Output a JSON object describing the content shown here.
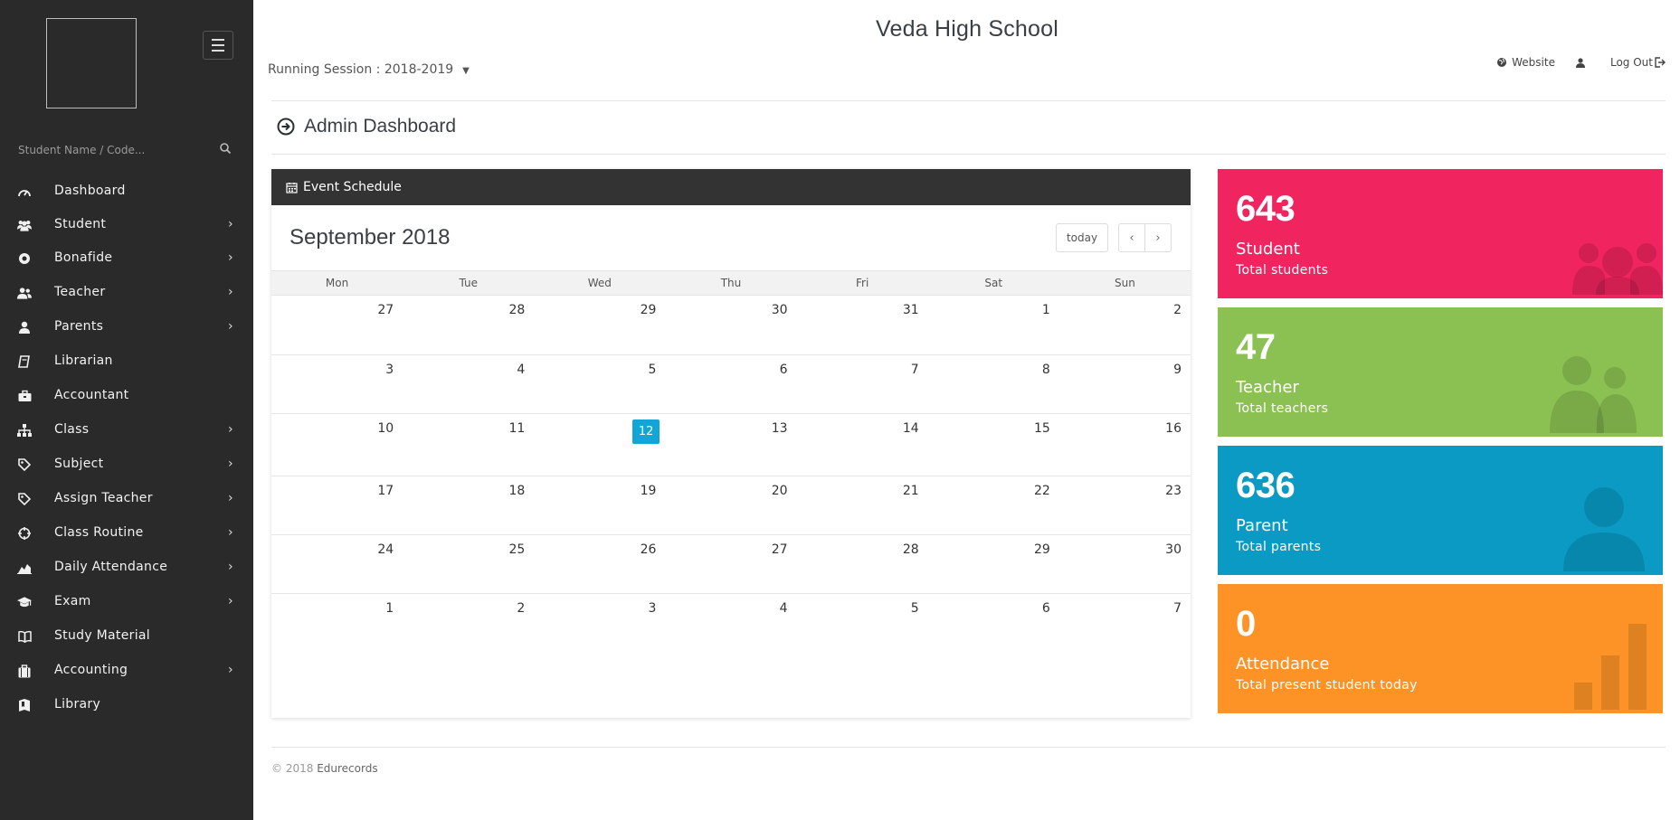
{
  "sidebar": {
    "search_placeholder": "Student Name / Code...",
    "items": [
      {
        "label": "Dashboard",
        "icon": "dashboard-gauge-icon",
        "has_submenu": false
      },
      {
        "label": "Student",
        "icon": "users-group-icon",
        "has_submenu": true
      },
      {
        "label": "Bonafide",
        "icon": "circle-dot-icon",
        "has_submenu": true
      },
      {
        "label": "Teacher",
        "icon": "user-pair-icon",
        "has_submenu": true
      },
      {
        "label": "Parents",
        "icon": "user-icon",
        "has_submenu": true
      },
      {
        "label": "Librarian",
        "icon": "book-icon",
        "has_submenu": false
      },
      {
        "label": "Accountant",
        "icon": "briefcase-icon",
        "has_submenu": false
      },
      {
        "label": "Class",
        "icon": "sitemap-icon",
        "has_submenu": true
      },
      {
        "label": "Subject",
        "icon": "tag-icon",
        "has_submenu": true
      },
      {
        "label": "Assign Teacher",
        "icon": "tag-icon",
        "has_submenu": true
      },
      {
        "label": "Class Routine",
        "icon": "crosshair-icon",
        "has_submenu": true
      },
      {
        "label": "Daily Attendance",
        "icon": "area-chart-icon",
        "has_submenu": true
      },
      {
        "label": "Exam",
        "icon": "graduation-cap-icon",
        "has_submenu": true
      },
      {
        "label": "Study Material",
        "icon": "open-book-icon",
        "has_submenu": false
      },
      {
        "label": "Accounting",
        "icon": "suitcase-icon",
        "has_submenu": true
      },
      {
        "label": "Library",
        "icon": "bookmark-book-icon",
        "has_submenu": false
      }
    ],
    "chevron": "›"
  },
  "header": {
    "school_name": "Veda High School",
    "session_label": "Running Session : 2018-2019",
    "session_caret": "▼",
    "links": {
      "website": "Website",
      "logout": "Log Out"
    }
  },
  "page": {
    "title": "Admin Dashboard"
  },
  "calendar": {
    "panel_title": "Event Schedule",
    "month_title": "September 2018",
    "today_label": "today",
    "prev_label": "‹",
    "next_label": "›",
    "days_of_week": [
      "Mon",
      "Tue",
      "Wed",
      "Thu",
      "Fri",
      "Sat",
      "Sun"
    ],
    "weeks": [
      [
        "27",
        "28",
        "29",
        "30",
        "31",
        "1",
        "2"
      ],
      [
        "3",
        "4",
        "5",
        "6",
        "7",
        "8",
        "9"
      ],
      [
        "10",
        "11",
        "12",
        "13",
        "14",
        "15",
        "16"
      ],
      [
        "17",
        "18",
        "19",
        "20",
        "21",
        "22",
        "23"
      ],
      [
        "24",
        "25",
        "26",
        "27",
        "28",
        "29",
        "30"
      ],
      [
        "1",
        "2",
        "3",
        "4",
        "5",
        "6",
        "7"
      ]
    ],
    "today_date": "12",
    "today_color": "#12a6d6"
  },
  "stats": [
    {
      "count": "643",
      "label": "Student",
      "sub": "Total students",
      "color": "#f0245f",
      "icon": "users-group-icon"
    },
    {
      "count": "47",
      "label": "Teacher",
      "sub": "Total teachers",
      "color": "#8bc152",
      "icon": "user-pair-icon"
    },
    {
      "count": "636",
      "label": "Parent",
      "sub": "Total parents",
      "color": "#0a9ac4",
      "icon": "user-icon"
    },
    {
      "count": "0",
      "label": "Attendance",
      "sub": "Total present student today",
      "color": "#fd9326",
      "icon": "bar-chart-icon"
    }
  ],
  "footer": {
    "copyright": "© 2018",
    "brand": "Edurecords"
  }
}
